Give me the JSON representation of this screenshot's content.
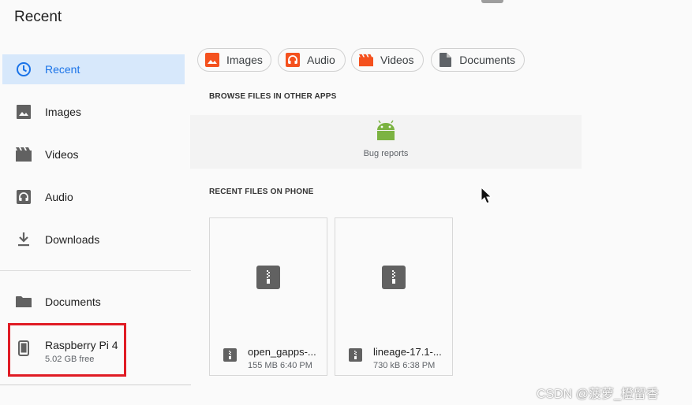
{
  "header": {
    "title": "Recent"
  },
  "sidebar": {
    "items": [
      {
        "label": "Recent",
        "icon": "clock-icon"
      },
      {
        "label": "Images",
        "icon": "image-icon"
      },
      {
        "label": "Videos",
        "icon": "movie-icon"
      },
      {
        "label": "Audio",
        "icon": "headphones-icon"
      },
      {
        "label": "Downloads",
        "icon": "download-icon"
      },
      {
        "label": "Documents",
        "icon": "folder-icon"
      }
    ],
    "device": {
      "name": "Raspberry Pi 4",
      "free": "5.02 GB free",
      "icon": "phone-icon"
    }
  },
  "filters": [
    {
      "label": "Images",
      "color": "#f4511e"
    },
    {
      "label": "Audio",
      "color": "#f4511e"
    },
    {
      "label": "Videos",
      "color": "#f4511e"
    },
    {
      "label": "Documents",
      "color": "#5f6368"
    }
  ],
  "browse": {
    "heading": "BROWSE FILES IN OTHER APPS",
    "apps": [
      {
        "label": "Bug reports",
        "icon": "android-icon",
        "color": "#7cb342"
      }
    ]
  },
  "recent_files": {
    "heading": "RECENT FILES ON PHONE",
    "files": [
      {
        "name": "open_gapps-...",
        "meta": "155 MB 6:40 PM"
      },
      {
        "name": "lineage-17.1-...",
        "meta": "730 kB 6:38 PM"
      }
    ]
  },
  "watermark": "CSDN @菠萝_橙留香",
  "colors": {
    "accent": "#1a73e8",
    "active_bg": "#d7e8fb",
    "highlight": "#e01b24"
  }
}
